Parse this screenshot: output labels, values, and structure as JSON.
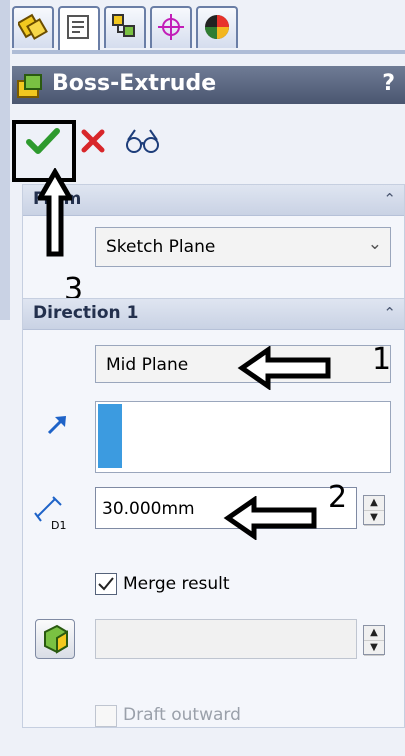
{
  "titlebar": {
    "title": "Boss-Extrude",
    "help": "?"
  },
  "from_group": {
    "title": "From",
    "value": "Sketch Plane"
  },
  "direction1": {
    "title": "Direction 1",
    "end_condition": "Mid Plane",
    "depth": "30.000mm",
    "depth_icon_label": "D1",
    "merge_label": "Merge result",
    "merge_checked": true,
    "draft_label": "Draft outward"
  },
  "annotations": {
    "one": "1",
    "two": "2",
    "three": "3"
  },
  "colors": {
    "ok": "#2e9a2e",
    "cancel": "#d8262a",
    "accent": "#3c9be0"
  }
}
